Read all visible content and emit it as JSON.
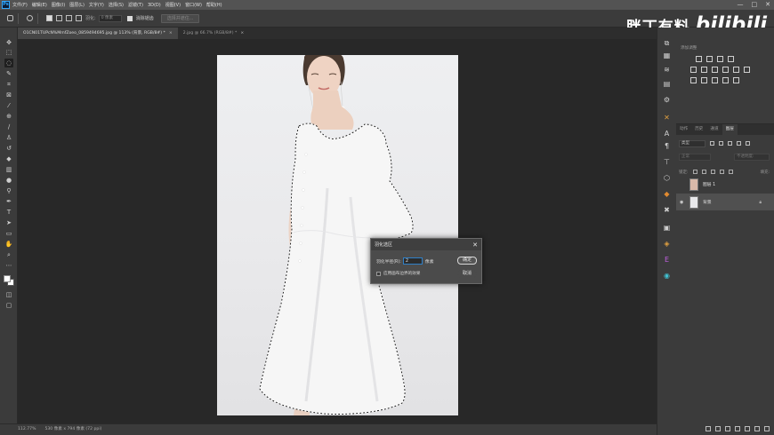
{
  "menubar": {
    "logo": "Ps",
    "items": [
      "文件(F)",
      "编辑(E)",
      "图像(I)",
      "图层(L)",
      "文字(Y)",
      "选择(S)",
      "滤镜(T)",
      "3D(D)",
      "视图(V)",
      "窗口(W)",
      "帮助(H)"
    ],
    "window_controls": [
      "—",
      "□",
      "✕"
    ]
  },
  "watermark": {
    "author": "胖丁有料",
    "site": "bilibili"
  },
  "options": {
    "feather_label": "羽化:",
    "feather_value": "0 像素",
    "antialias_label": "消除锯齿",
    "select_mask_button": "选择并遮住..."
  },
  "tabs": [
    {
      "label": "O1CN01TUPcN%MmfZoeo_0859494695.jpg @ 113% (背景, RGB/8#) *",
      "close": "×",
      "active": true
    },
    {
      "label": "2.jpg @ 66.7% (RGB/8#) *",
      "close": "×",
      "active": false
    }
  ],
  "status": {
    "zoom": "112.77%",
    "doc_info": "530 像素 x 794 像素 (72 ppi)"
  },
  "dialog": {
    "title": "羽化选区",
    "close": "✕",
    "radius_label": "羽化半径(R):",
    "radius_value": "2",
    "unit": "像素",
    "checkbox_label": "应用画布边界的效果",
    "checkbox_checked": false,
    "ok_label": "确定",
    "cancel_label": "取消"
  },
  "right_panel": {
    "adjust_title": "添加调整",
    "tabs": [
      "动作",
      "历史",
      "通道",
      "图层"
    ],
    "active_tab": "图层",
    "kind_select": "类型",
    "blend_mode": "正常",
    "opacity": "不透明度:",
    "lock_label": "锁定:",
    "fill": "填充:",
    "layers": [
      {
        "name": "图层 1",
        "visible": false,
        "selected": false,
        "locked": false
      },
      {
        "name": "背景",
        "visible": true,
        "selected": true,
        "locked": true
      }
    ]
  },
  "colors": {
    "accent": "#31a8ff",
    "ui_dark": "#282828",
    "ui_panel": "#3b3b3b",
    "menubar": "#535353"
  }
}
